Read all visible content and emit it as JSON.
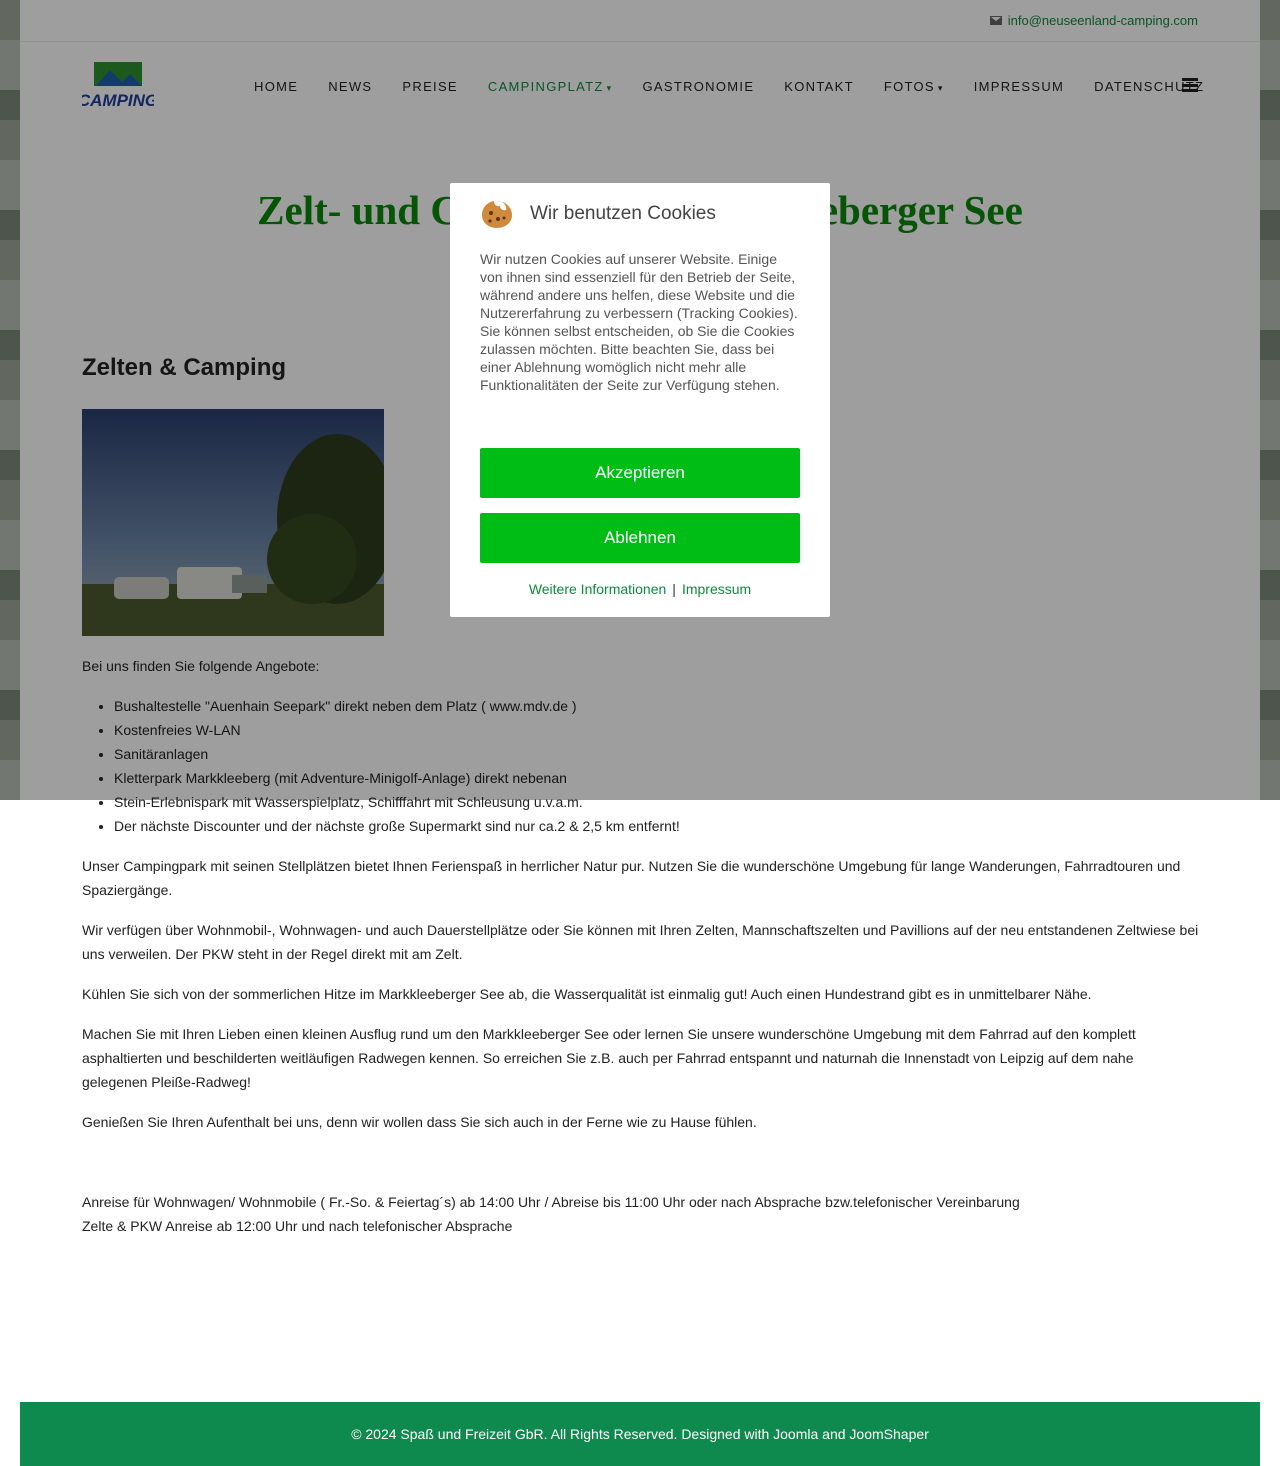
{
  "topbar": {
    "email": "info@neuseenland-camping.com",
    "email_icon": "envelope-icon"
  },
  "header": {
    "logo_text": "CAMPING",
    "nav": [
      {
        "label": "HOME"
      },
      {
        "label": "NEWS"
      },
      {
        "label": "PREISE"
      },
      {
        "label": "CAMPINGPLATZ",
        "caret": "▾",
        "active": true
      },
      {
        "label": "GASTRONOMIE"
      },
      {
        "label": "KONTAKT"
      },
      {
        "label": "FOTOS",
        "caret": "▾"
      },
      {
        "label": "IMPRESSUM"
      },
      {
        "label": "DATENSCHUTZ"
      }
    ],
    "menu_icon": "hamburger-icon"
  },
  "main": {
    "title": "Zelt- und Camping am Markkleeberger See",
    "section_title": "Zelten & Camping",
    "intro": "Bei uns finden Sie folgende Angebote:",
    "offers": [
      "Bushaltestelle \"Auenhain Seepark\" direkt neben dem Platz ( www.mdv.de )",
      "Kostenfreies W-LAN",
      "Sanitäranlagen",
      "Kletterpark Markkleeberg (mit Adventure-Minigolf-Anlage) direkt nebenan",
      "Stein-Erlebnispark mit Wasserspielplatz, Schifffahrt mit Schleusung u.v.a.m.",
      "Der nächste Discounter und der nächste große Supermarkt sind nur ca.2 & 2,5 km entfernt!"
    ],
    "paragraphs": [
      "Unser Campingpark mit seinen Stellplätzen bietet Ihnen Ferienspaß in herrlicher Natur pur. Nutzen Sie die wunderschöne Umgebung für lange Wanderungen, Fahrradtouren und Spaziergänge.",
      "Wir verfügen über Wohnmobil-, Wohnwagen- und auch Dauerstellplätze oder Sie können mit Ihren Zelten, Mannschaftszelten und Pavillions auf der neu entstandenen Zeltwiese bei uns verweilen. Der PKW steht in der Regel direkt mit am Zelt.",
      "Kühlen Sie sich von der sommerlichen Hitze im Markkleeberger See ab, die Wasserqualität ist einmalig gut! Auch einen Hundestrand gibt es in unmittelbarer Nähe.",
      "Machen Sie mit Ihren Lieben einen kleinen Ausflug rund um den Markkleeberger See oder lernen Sie unsere wunderschöne Umgebung mit dem Fahrrad auf den komplett asphaltierten und beschilderten weitläufigen Radwegen kennen. So erreichen Sie z.B. auch per Fahrrad entspannt und naturnah die Innenstadt von Leipzig auf dem nahe gelegenen Pleiße-Radweg!",
      "Genießen Sie Ihren Aufenthalt bei uns, denn wir wollen dass Sie sich auch in der Ferne wie zu Hause fühlen."
    ],
    "arrival_1": "Anreise für Wohnwagen/ Wohnmobile ( Fr.-So. & Feiertag´s) ab 14:00 Uhr / Abreise bis 11:00 Uhr oder nach Absprache bzw.telefonischer Vereinbarung",
    "arrival_2": "Zelte & PKW Anreise ab 12:00 Uhr und nach telefonischer Absprache"
  },
  "footer": {
    "text": "© 2024 Spaß und Freizeit GbR. All Rights Reserved. Designed with Joomla and JoomShaper"
  },
  "cookie": {
    "icon": "cookie-icon",
    "title": "Wir benutzen Cookies",
    "text": "Wir nutzen Cookies auf unserer Website. Einige von ihnen sind essenziell für den Betrieb der Seite, während andere uns helfen, diese Website und die Nutzererfahrung zu verbessern (Tracking Cookies). Sie können selbst entscheiden, ob Sie die Cookies zulassen möchten. Bitte beachten Sie, dass bei einer Ablehnung womöglich nicht mehr alle Funktionalitäten der Seite zur Verfügung stehen.",
    "accept_label": "Akzeptieren",
    "decline_label": "Ablehnen",
    "more_info_label": "Weitere Informationen",
    "separator": "|",
    "imprint_label": "Impressum"
  },
  "colors": {
    "brand_green": "#0e8a3e",
    "title_green": "#0a8a0a",
    "button_green": "#00bd16",
    "footer_green": "#0e8a4e"
  }
}
